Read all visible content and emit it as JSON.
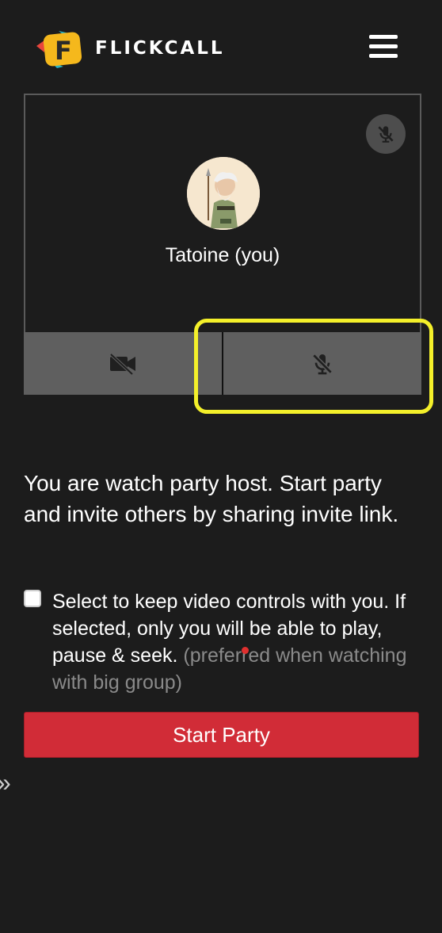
{
  "header": {
    "logo_text": "FLICKCALL",
    "logo_letter": "F",
    "menu_icon": "hamburger-menu-icon"
  },
  "video_tile": {
    "participant_name": "Tatoine (you)",
    "mute_indicator_icon": "mic-off-icon",
    "controls": {
      "camera_icon": "camera-off-icon",
      "mic_icon": "mic-off-icon"
    }
  },
  "host_message": "You are watch party host. Start party and invite others by sharing invite link.",
  "video_controls_option": {
    "checked": false,
    "text": "Select to keep video controls with you. If selected, only you will be able to play, pause & seek.",
    "note": "(preferred when watching with big group)"
  },
  "start_button": {
    "label": "Start Party"
  },
  "side_toggle": {
    "icon": "double-chevron-right-icon",
    "glyph": "»"
  },
  "colors": {
    "background": "#1c1c1c",
    "accent_red": "#d12c37",
    "highlight_yellow": "#f4f02a",
    "control_bar": "#5f5f5f",
    "logo_yellow": "#f5b81c"
  }
}
